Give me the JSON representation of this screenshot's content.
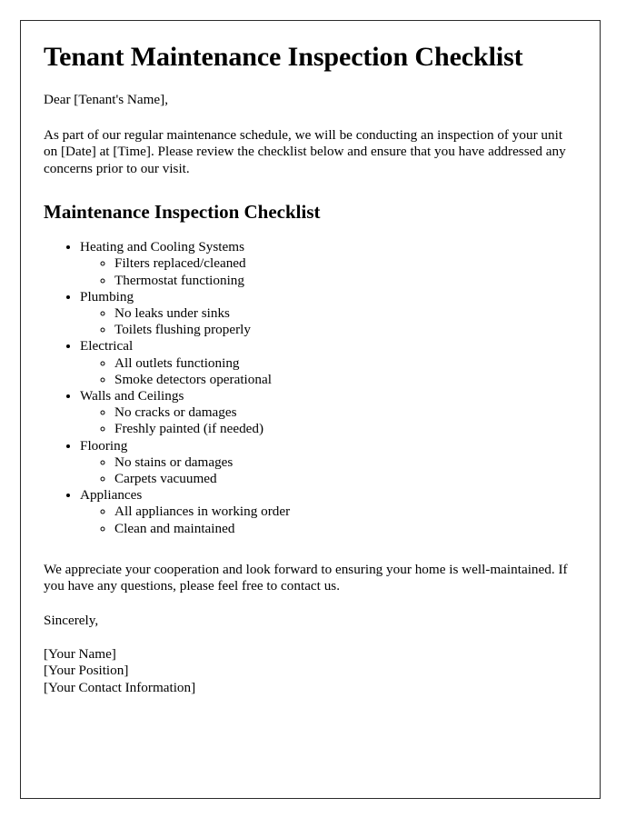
{
  "document": {
    "title": "Tenant Maintenance Inspection Checklist",
    "salutation": "Dear [Tenant's Name],",
    "intro_paragraph": "As part of our regular maintenance schedule, we will be conducting an inspection of your unit on [Date] at [Time]. Please review the checklist below and ensure that you have addressed any concerns prior to our visit.",
    "section_heading": "Maintenance Inspection Checklist",
    "closing_paragraph": "We appreciate your cooperation and look forward to ensuring your home is well-maintained. If you have any questions, please feel free to contact us.",
    "sincerely": "Sincerely,",
    "signature": {
      "name": "[Your Name]",
      "position": "[Your Position]",
      "contact": "[Your Contact Information]"
    },
    "checklist": [
      {
        "label": "Heating and Cooling Systems",
        "items": [
          "Filters replaced/cleaned",
          "Thermostat functioning"
        ]
      },
      {
        "label": "Plumbing",
        "items": [
          "No leaks under sinks",
          "Toilets flushing properly"
        ]
      },
      {
        "label": "Electrical",
        "items": [
          "All outlets functioning",
          "Smoke detectors operational"
        ]
      },
      {
        "label": "Walls and Ceilings",
        "items": [
          "No cracks or damages",
          "Freshly painted (if needed)"
        ]
      },
      {
        "label": "Flooring",
        "items": [
          "No stains or damages",
          "Carpets vacuumed"
        ]
      },
      {
        "label": "Appliances",
        "items": [
          "All appliances in working order",
          "Clean and maintained"
        ]
      }
    ]
  },
  "style": {
    "page_background": "#ffffff",
    "text_color": "#000000",
    "border_color": "#2b2b2b"
  }
}
